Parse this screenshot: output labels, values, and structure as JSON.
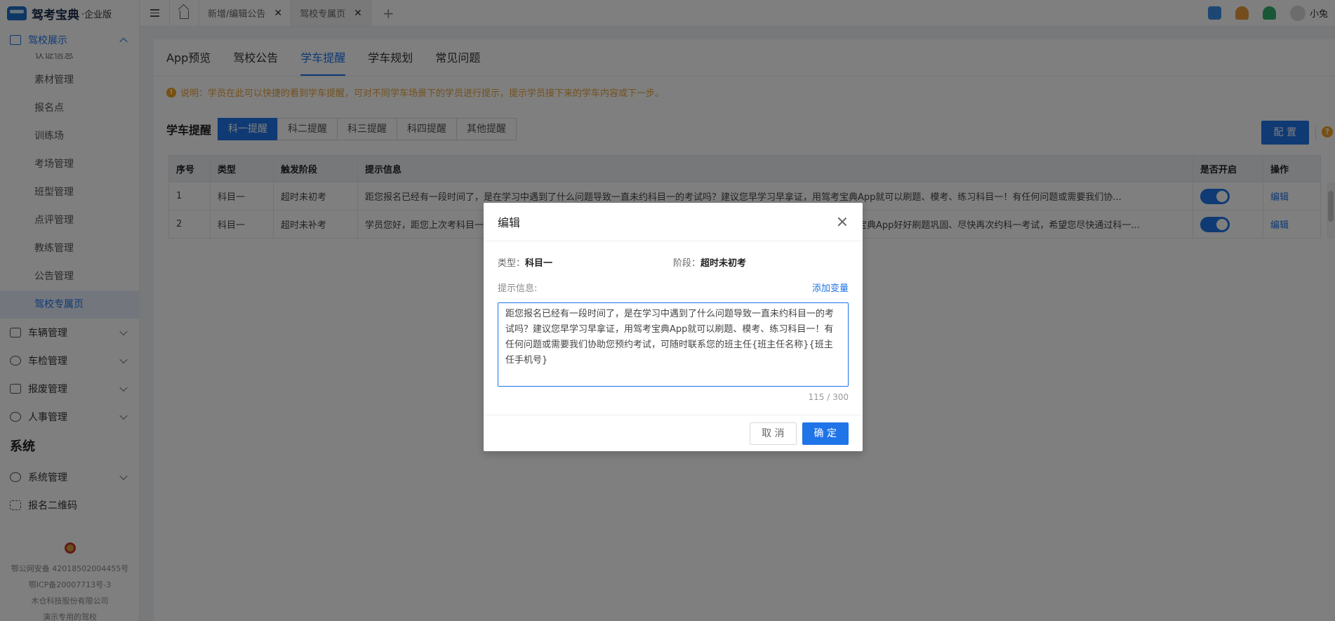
{
  "sidebar": {
    "brand": "驾考宝典",
    "brand_sub": "·企业版",
    "group_title": "驾校展示",
    "cut_item": "认证信息",
    "sub_items": [
      "素材管理",
      "报名点",
      "训练场",
      "考场管理",
      "班型管理",
      "点评管理",
      "教练管理",
      "公告管理",
      "驾校专属页"
    ],
    "menu": [
      "车辆管理",
      "车检管理",
      "报废管理",
      "人事管理"
    ],
    "section": "系统",
    "system_menu": [
      "系统管理",
      "报名二维码"
    ],
    "footer": [
      "鄂公网安备 42018502004455号",
      "鄂ICP备20007713号-3",
      "木仓科技股份有限公司",
      "演示专用的驾校"
    ]
  },
  "topbar": {
    "tabs": [
      "新增/编辑公告",
      "驾校专属页"
    ],
    "user_name": "小兔"
  },
  "main": {
    "tabs": [
      "App预览",
      "驾校公告",
      "学车提醒",
      "学车规划",
      "常见问题"
    ],
    "notice": "说明：学员在此可以快捷的看到学车提醒，可对不同学车场景下的学员进行提示，提示学员接下来的学车内容或下一步。",
    "filter_title": "学车提醒",
    "segments": [
      "科一提醒",
      "科二提醒",
      "科三提醒",
      "科四提醒",
      "其他提醒"
    ],
    "config_label": "配 置",
    "table": {
      "headers": [
        "序号",
        "类型",
        "触发阶段",
        "提示信息",
        "是否开启",
        "操作"
      ],
      "rows": [
        {
          "no": "1",
          "type": "科目一",
          "stage": "超时未初考",
          "msg": "距您报名已经有一段时间了，是在学习中遇到了什么问题导致一直未约科目一的考试吗？建议您早学习早拿证，用驾考宝典App就可以刷题、模考、练习科目一！有任何问题或需要我们协...",
          "action": "编辑"
        },
        {
          "no": "2",
          "type": "科目一",
          "stage": "超时未补考",
          "msg": "学员您好，距您上次考科目一已经有一段时间了，是在学习中遇到了什么问题导致一直未约科目一的补考吗？建议您用驾考宝典App好好刷题巩固、尽快再次约科一考试，希望您尽快通过科一...",
          "action": "编辑"
        }
      ]
    }
  },
  "modal": {
    "title": "编辑",
    "type_label": "类型：",
    "type_value": "科目一",
    "stage_label": "阶段：",
    "stage_value": "超时未初考",
    "hint_label": "提示信息:",
    "add_var": "添加变量",
    "content": "距您报名已经有一段时间了，是在学习中遇到了什么问题导致一直未约科目一的考试吗？建议您早学习早拿证，用驾考宝典App就可以刷题、模考、练习科目一！有任何问题或需要我们协助您预约考试，可随时联系您的班主任{班主任名称}{班主任手机号}",
    "counter": "115 / 300",
    "cancel": "取 消",
    "ok": "确 定"
  }
}
